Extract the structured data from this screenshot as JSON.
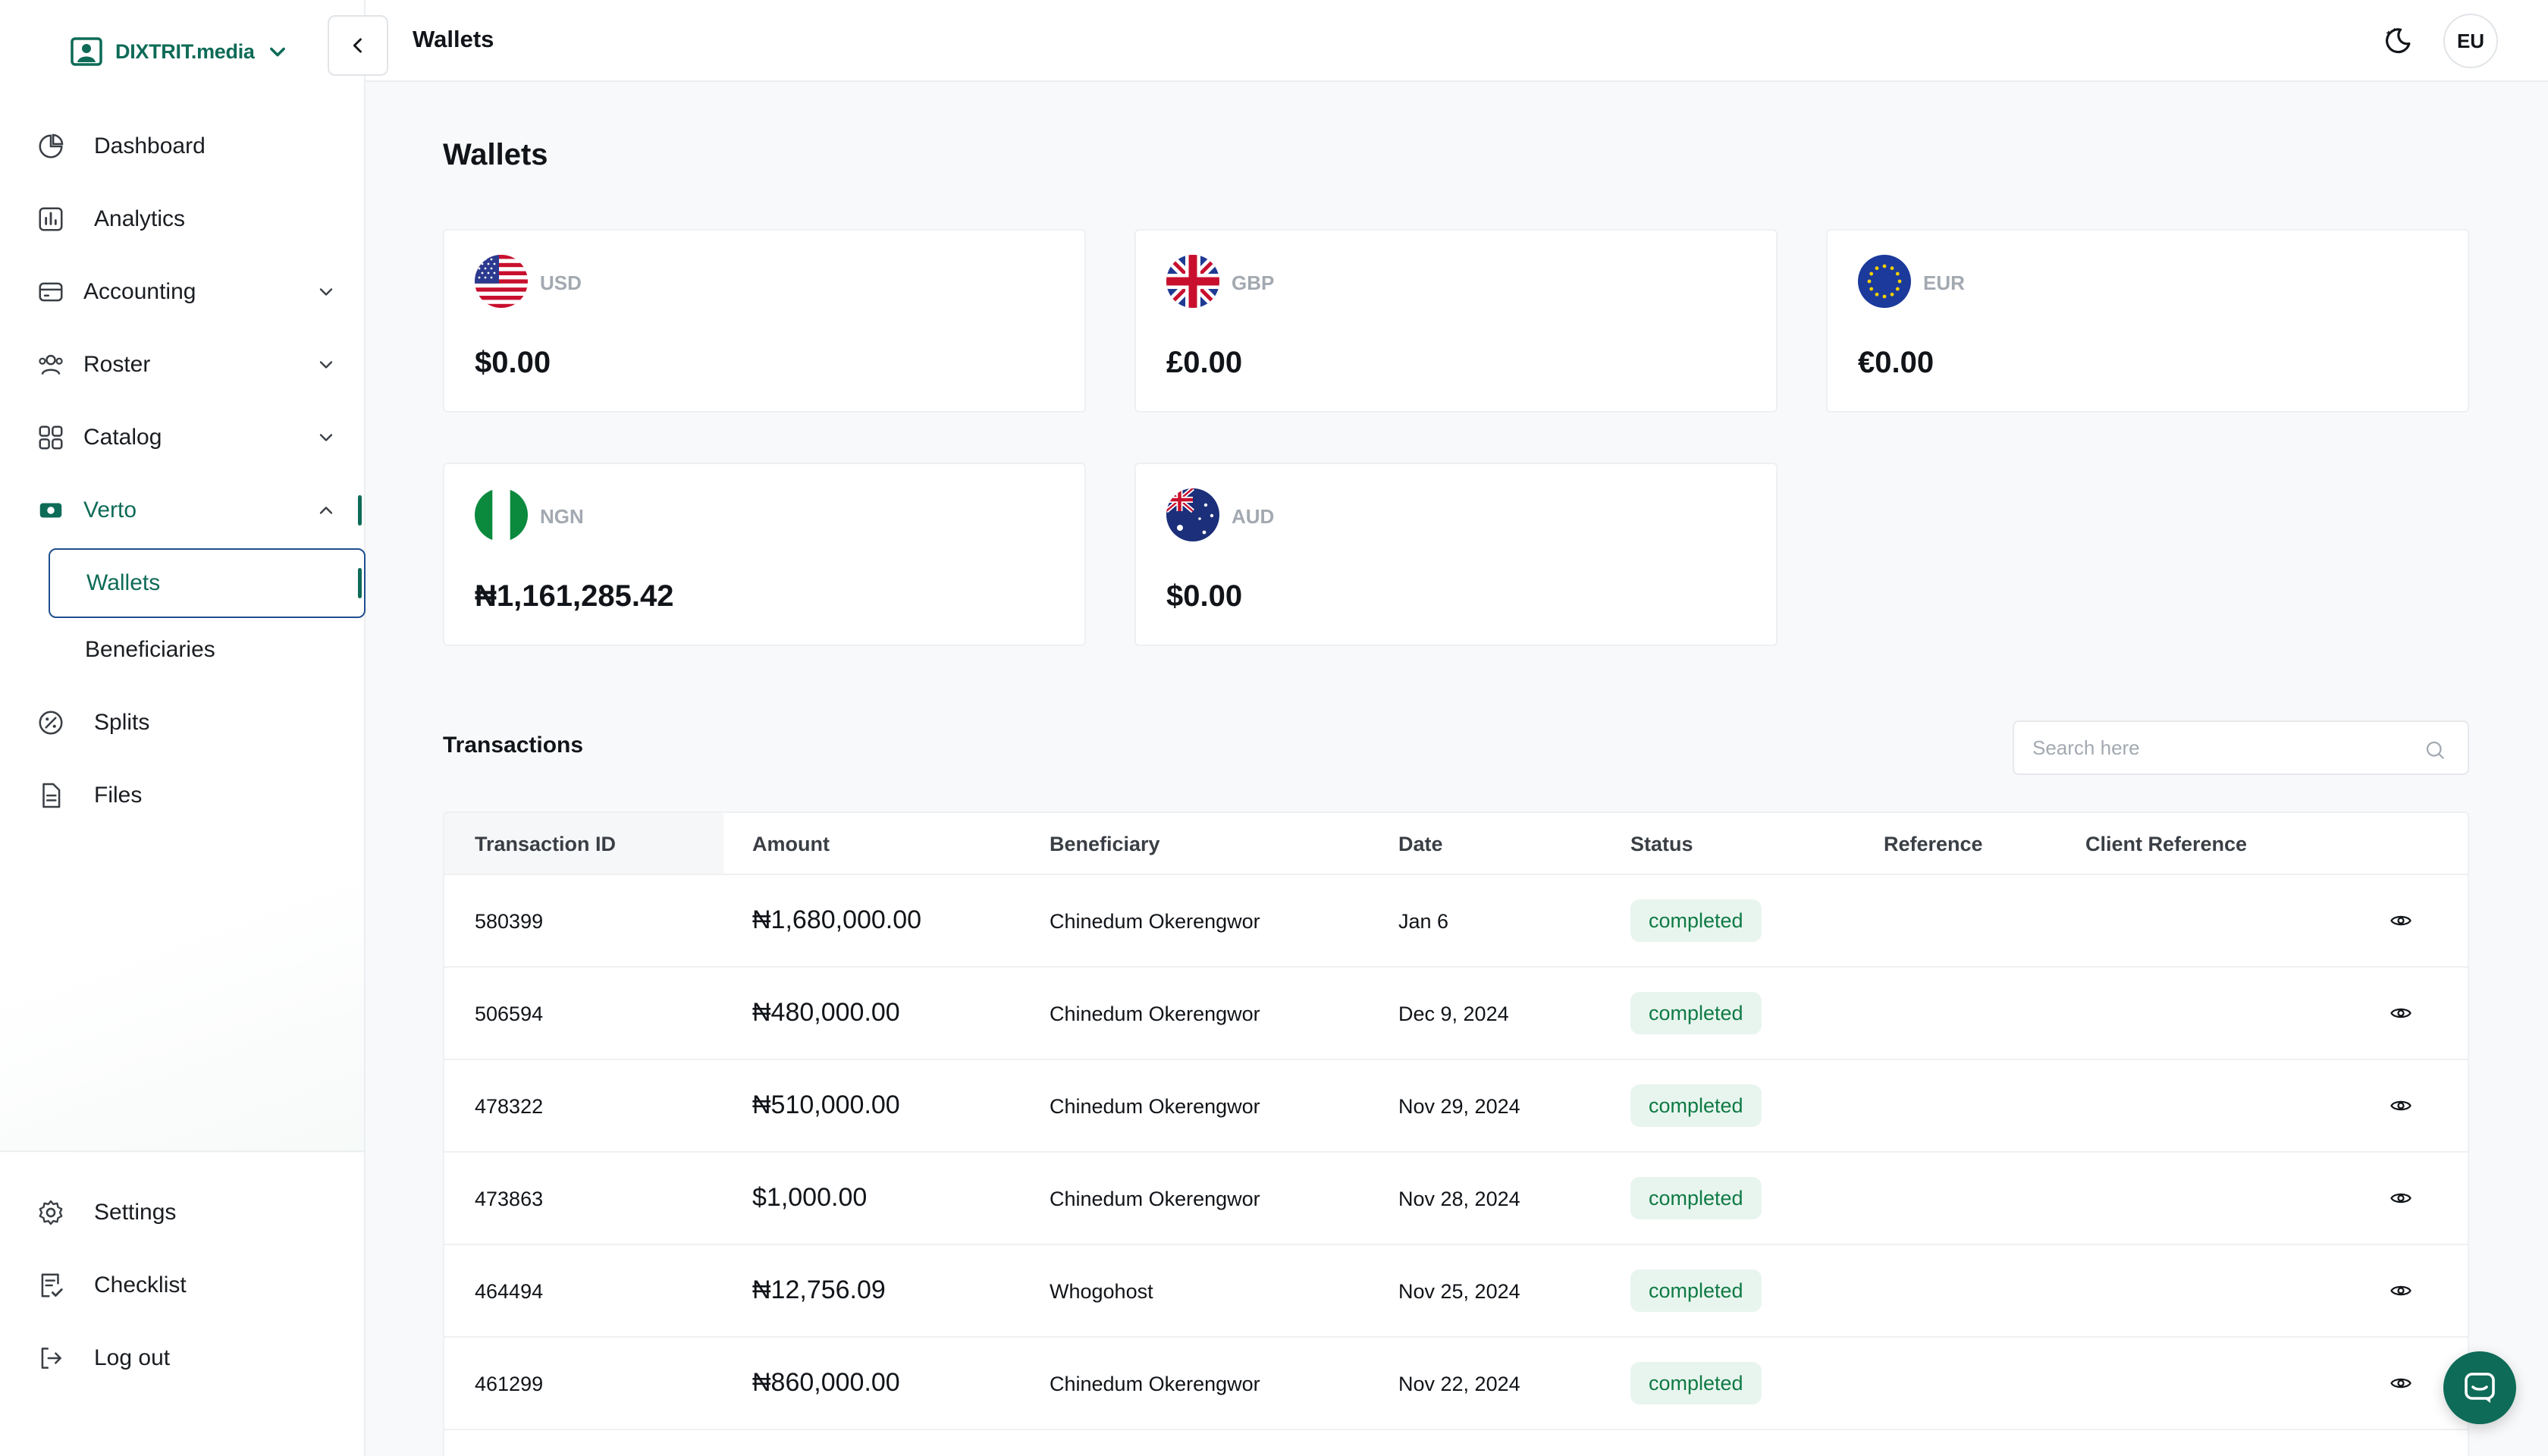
{
  "app": {
    "brand_name": "DIXTRIT.media",
    "topbar_title": "Wallets",
    "user_initials": "EU",
    "colors": {
      "brand": "#0d6b57",
      "status_ok_bg": "#e8f5ee",
      "status_ok_fg": "#0f7a45"
    }
  },
  "sidebar": {
    "items": [
      {
        "label": "Dashboard",
        "icon": "dashboard-icon"
      },
      {
        "label": "Analytics",
        "icon": "analytics-icon"
      },
      {
        "label": "Accounting",
        "icon": "accounting-icon"
      },
      {
        "label": "Roster",
        "icon": "roster-icon"
      },
      {
        "label": "Catalog",
        "icon": "catalog-icon"
      },
      {
        "label": "Verto",
        "icon": "verto-icon"
      },
      {
        "label": "Splits",
        "icon": "splits-icon"
      },
      {
        "label": "Files",
        "icon": "files-icon"
      }
    ],
    "verto_subitems": [
      {
        "label": "Wallets"
      },
      {
        "label": "Beneficiaries"
      }
    ],
    "footer_items": [
      {
        "label": "Settings",
        "icon": "gear-icon"
      },
      {
        "label": "Checklist",
        "icon": "checklist-icon"
      },
      {
        "label": "Log out",
        "icon": "logout-icon"
      }
    ]
  },
  "main": {
    "page_title": "Wallets",
    "wallets": [
      {
        "currency": "USD",
        "balance": "$0.00",
        "flag": "us-flag-icon"
      },
      {
        "currency": "GBP",
        "balance": "£0.00",
        "flag": "uk-flag-icon"
      },
      {
        "currency": "EUR",
        "balance": "€0.00",
        "flag": "eu-flag-icon"
      },
      {
        "currency": "NGN",
        "balance": "₦1,161,285.42",
        "flag": "ng-flag-icon"
      },
      {
        "currency": "AUD",
        "balance": "$0.00",
        "flag": "au-flag-icon"
      }
    ],
    "transactions": {
      "title": "Transactions",
      "search_placeholder": "Search here",
      "columns": [
        "Transaction ID",
        "Amount",
        "Beneficiary",
        "Date",
        "Status",
        "Reference",
        "Client Reference"
      ],
      "rows": [
        {
          "id": "580399",
          "amount": "₦1,680,000.00",
          "beneficiary": "Chinedum Okerengwor",
          "date": "Jan 6",
          "status": "completed",
          "reference": "",
          "client_reference": ""
        },
        {
          "id": "506594",
          "amount": "₦480,000.00",
          "beneficiary": "Chinedum Okerengwor",
          "date": "Dec 9, 2024",
          "status": "completed",
          "reference": "",
          "client_reference": ""
        },
        {
          "id": "478322",
          "amount": "₦510,000.00",
          "beneficiary": "Chinedum Okerengwor",
          "date": "Nov 29, 2024",
          "status": "completed",
          "reference": "",
          "client_reference": ""
        },
        {
          "id": "473863",
          "amount": "$1,000.00",
          "beneficiary": "Chinedum Okerengwor",
          "date": "Nov 28, 2024",
          "status": "completed",
          "reference": "",
          "client_reference": ""
        },
        {
          "id": "464494",
          "amount": "₦12,756.09",
          "beneficiary": "Whogohost",
          "date": "Nov 25, 2024",
          "status": "completed",
          "reference": "",
          "client_reference": ""
        },
        {
          "id": "461299",
          "amount": "₦860,000.00",
          "beneficiary": "Chinedum Okerengwor",
          "date": "Nov 22, 2024",
          "status": "completed",
          "reference": "",
          "client_reference": ""
        }
      ]
    }
  }
}
